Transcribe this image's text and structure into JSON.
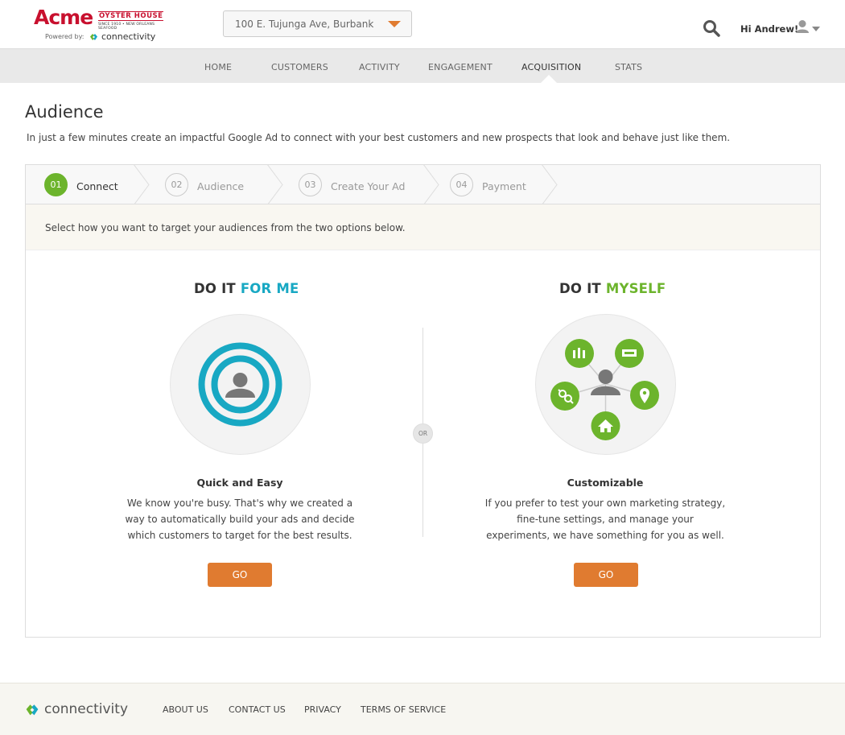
{
  "brand": {
    "name": "Acme",
    "subname": "OYSTER HOUSE",
    "tagline": "SINCE 1910 • NEW ORLEANS SEAFOOD",
    "powered_by": "Powered by:",
    "partner": "connectivity"
  },
  "header": {
    "location": "100 E. Tujunga Ave, Burbank",
    "greeting": "Hi Andrew!"
  },
  "nav": {
    "items": [
      {
        "label": "HOME"
      },
      {
        "label": "CUSTOMERS"
      },
      {
        "label": "ACTIVITY"
      },
      {
        "label": "ENGAGEMENT"
      },
      {
        "label": "ACQUISITION"
      },
      {
        "label": "STATS"
      }
    ],
    "active": "ACQUISITION"
  },
  "page": {
    "title": "Audience",
    "description": "In just a few minutes create an impactful Google Ad to connect with your best customers and new prospects that look and behave just like them."
  },
  "wizard": {
    "steps": [
      {
        "num": "01",
        "label": "Connect"
      },
      {
        "num": "02",
        "label": "Audience"
      },
      {
        "num": "03",
        "label": "Create Your Ad"
      },
      {
        "num": "04",
        "label": "Payment"
      }
    ],
    "instruction": "Select how you want to target your audiences from the two options below.",
    "or_label": "OR",
    "option_left": {
      "title_prefix": "DO IT",
      "title_highlight": "FOR ME",
      "heading": "Quick and Easy",
      "body": "We know you're busy. That's why we created a way to automatically build your ads and decide which customers to target for the best results.",
      "button": "GO"
    },
    "option_right": {
      "title_prefix": "DO IT",
      "title_highlight": "MYSELF",
      "heading": "Customizable",
      "body": "If you prefer to test your own marketing strategy, fine-tune settings, and manage your experiments, we have something for you as well.",
      "button": "GO"
    }
  },
  "footer": {
    "brand": "connectivity",
    "links": [
      {
        "label": "ABOUT US"
      },
      {
        "label": "CONTACT US"
      },
      {
        "label": "PRIVACY"
      },
      {
        "label": "TERMS OF SERVICE"
      }
    ]
  },
  "colors": {
    "accent_orange": "#e07b30",
    "accent_green": "#6cb42c",
    "accent_blue": "#18a8c3",
    "brand_red": "#c8102e"
  }
}
